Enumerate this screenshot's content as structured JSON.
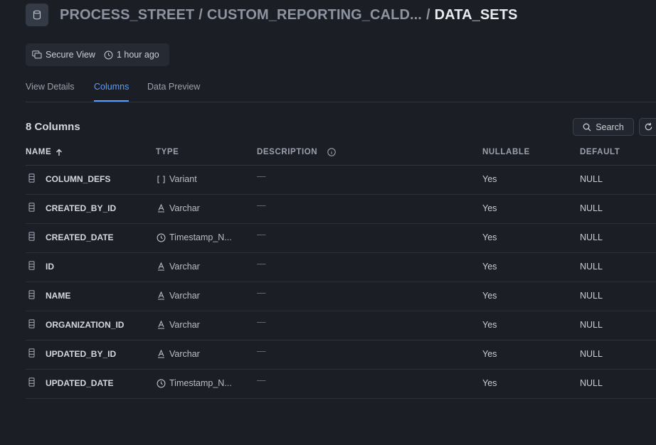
{
  "header": {
    "crumbs": [
      "PROCESS_STREET",
      "CUSTOM_REPORTING_CALD..."
    ],
    "separator": "/",
    "current": "DATA_SETS",
    "object_icon": "database-icon"
  },
  "meta": {
    "view_type": "Secure View",
    "updated": "1 hour ago"
  },
  "tabs": [
    {
      "label": "View Details",
      "active": false
    },
    {
      "label": "Columns",
      "active": true
    },
    {
      "label": "Data Preview",
      "active": false
    }
  ],
  "toolbar": {
    "column_count": "8 Columns",
    "search_label": "Search"
  },
  "table": {
    "headers": {
      "name": "NAME",
      "type": "TYPE",
      "description": "DESCRIPTION",
      "nullable": "NULLABLE",
      "default": "DEFAULT"
    },
    "rows": [
      {
        "name": "COLUMN_DEFS",
        "type_icon": "brackets-icon",
        "type": "Variant",
        "description": "—",
        "nullable": "Yes",
        "default": "NULL"
      },
      {
        "name": "CREATED_BY_ID",
        "type_icon": "text-type-icon",
        "type": "Varchar",
        "description": "—",
        "nullable": "Yes",
        "default": "NULL"
      },
      {
        "name": "CREATED_DATE",
        "type_icon": "clock-icon",
        "type": "Timestamp_N...",
        "description": "—",
        "nullable": "Yes",
        "default": "NULL"
      },
      {
        "name": "ID",
        "type_icon": "text-type-icon",
        "type": "Varchar",
        "description": "—",
        "nullable": "Yes",
        "default": "NULL"
      },
      {
        "name": "NAME",
        "type_icon": "text-type-icon",
        "type": "Varchar",
        "description": "—",
        "nullable": "Yes",
        "default": "NULL"
      },
      {
        "name": "ORGANIZATION_ID",
        "type_icon": "text-type-icon",
        "type": "Varchar",
        "description": "—",
        "nullable": "Yes",
        "default": "NULL"
      },
      {
        "name": "UPDATED_BY_ID",
        "type_icon": "text-type-icon",
        "type": "Varchar",
        "description": "—",
        "nullable": "Yes",
        "default": "NULL"
      },
      {
        "name": "UPDATED_DATE",
        "type_icon": "clock-icon",
        "type": "Timestamp_N...",
        "description": "—",
        "nullable": "Yes",
        "default": "NULL"
      }
    ]
  },
  "colors": {
    "background": "#1b1e25",
    "accent": "#5b9dff",
    "text": "#d5d8de",
    "muted": "#9aa1ad"
  }
}
